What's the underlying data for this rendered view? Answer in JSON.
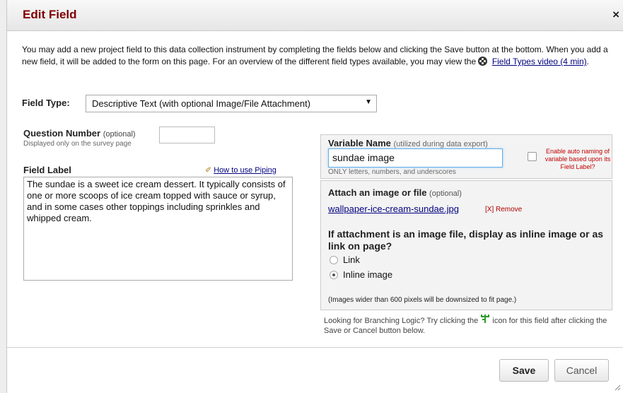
{
  "dialog": {
    "title": "Edit Field",
    "close_label": "×"
  },
  "intro": {
    "text_part1": "You may add a new project field to this data collection instrument by completing the fields below and clicking the Save button at the bottom. When you add a new field, it will be added to the form on this page. For an overview of the different field types available, you may view the ",
    "video_link": "Field Types video (4 min)",
    "text_part2": "."
  },
  "field_type": {
    "label": "Field Type:",
    "selected": "Descriptive Text (with optional Image/File Attachment)",
    "arrow": "▼"
  },
  "question_number": {
    "label": "Question Number",
    "optional": "(optional)",
    "sublabel": "Displayed only on the survey page",
    "value": ""
  },
  "field_label": {
    "label": "Field Label",
    "piping_link": "How to use Piping",
    "value": "The sundae is a sweet ice cream dessert. It typically consists of one or more scoops of ice cream topped with sauce or syrup, and in some cases other toppings including sprinkles and whipped cream."
  },
  "variable_name": {
    "label": "Variable Name",
    "note": "(utilized during data export)",
    "value": "sundae image",
    "hint": "ONLY letters, numbers, and underscores",
    "auto_naming": "Enable auto naming of variable based upon its Field Label?"
  },
  "attachment": {
    "label": "Attach an image or file",
    "optional": "(optional)",
    "file_name": "wallpaper-ice-cream-sundae.jpg",
    "remove_label": "[X] Remove",
    "question": "If attachment is an image file, display as inline image or as link on page?",
    "option_link": "Link",
    "option_inline": "Inline image",
    "selected": "Inline image",
    "note": "(Images wider than 600 pixels will be downsized to fit page.)"
  },
  "branching": {
    "text_before": "Looking for Branching Logic? Try clicking the ",
    "text_after": " icon for this field after clicking the Save or Cancel button below."
  },
  "buttons": {
    "save": "Save",
    "cancel": "Cancel"
  },
  "colors": {
    "title": "#800000",
    "link": "#000080",
    "remove": "#b00000",
    "auto_naming": "#c00000"
  }
}
